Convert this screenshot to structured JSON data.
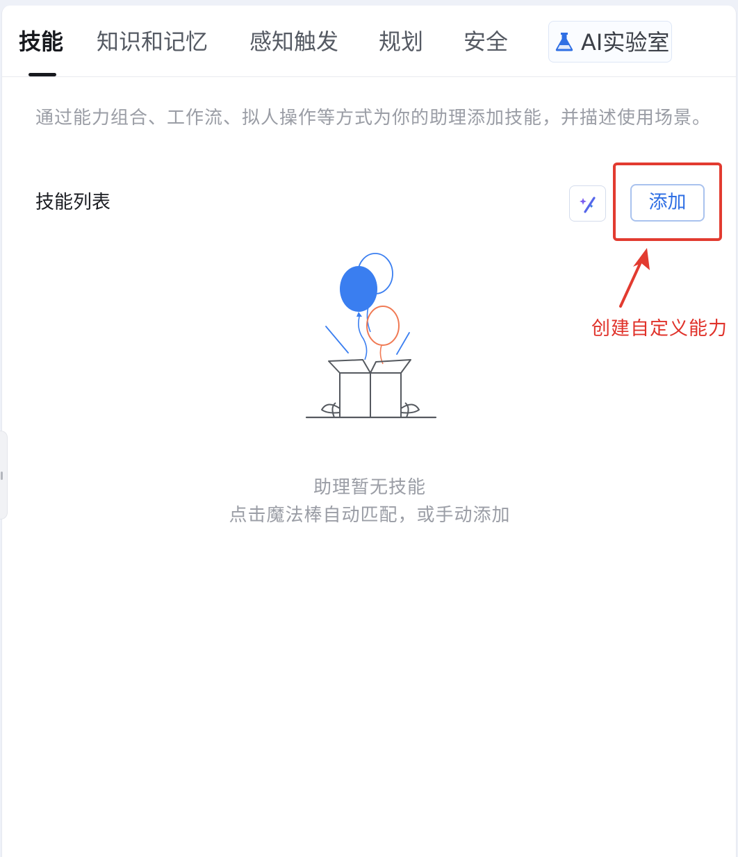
{
  "tabs": [
    {
      "label": "技能",
      "active": true
    },
    {
      "label": "知识和记忆",
      "active": false
    },
    {
      "label": "感知触发",
      "active": false
    },
    {
      "label": "规划",
      "active": false
    },
    {
      "label": "安全",
      "active": false
    }
  ],
  "lab_tab": {
    "label": "AI实验室",
    "icon": "flask-icon",
    "icon_color": "#2f6fe4"
  },
  "description": "通过能力组合、工作流、拟人操作等方式为你的助理添加技能，并描述使用场景。",
  "skills": {
    "title": "技能列表",
    "magic_button_icon": "magic-wand-icon",
    "add_label": "添加"
  },
  "annotation": {
    "text": "创建自定义能力",
    "color": "#e0322a"
  },
  "empty_state": {
    "illustration": "balloons-gift-box",
    "title": "助理暂无技能",
    "subtitle": "点击魔法棒自动匹配，或手动添加"
  },
  "colors": {
    "accent": "#2f6fe4",
    "balloon_blue": "#3a7ef0",
    "balloon_orange": "#f07a54"
  }
}
